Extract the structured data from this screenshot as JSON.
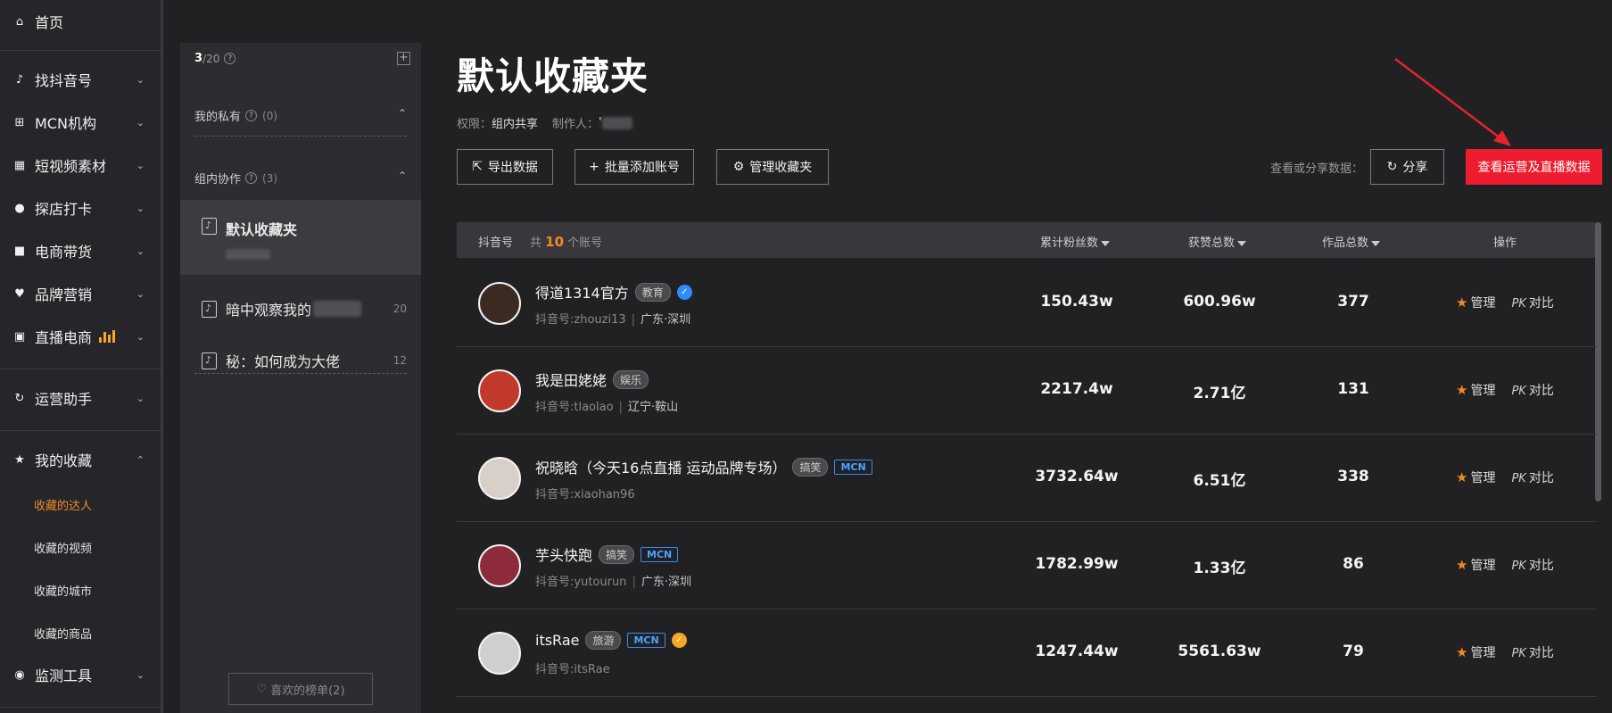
{
  "nav": {
    "home": "首页",
    "items": [
      {
        "label": "找抖音号",
        "icon": "music-note-icon"
      },
      {
        "label": "MCN机构",
        "icon": "org-icon"
      },
      {
        "label": "短视频素材",
        "icon": "grid-icon"
      },
      {
        "label": "探店打卡",
        "icon": "location-pin-icon"
      },
      {
        "label": "电商带货",
        "icon": "shop-bag-icon"
      },
      {
        "label": "品牌营销",
        "icon": "heart-icon"
      },
      {
        "label": "直播电商",
        "icon": "tv-icon"
      },
      {
        "label": "运营助手",
        "icon": "refresh-icon"
      },
      {
        "label": "我的收藏",
        "icon": "star-icon"
      },
      {
        "label": "监测工具",
        "icon": "pulse-icon"
      }
    ],
    "favorites_sub": [
      "收藏的达人",
      "收藏的视频",
      "收藏的城市",
      "收藏的商品"
    ]
  },
  "folders_panel": {
    "count": "3",
    "limit": "/20",
    "private_label": "我的私有",
    "private_count": "(0)",
    "group_label": "组内协作",
    "group_count": "(3)",
    "folders": [
      {
        "name": "默认收藏夹",
        "count": ""
      },
      {
        "name": "暗中观察我的",
        "count": "20"
      },
      {
        "name": "秘：如何成为大佬",
        "count": "12"
      }
    ],
    "liked_lists": "喜欢的榜单(2)"
  },
  "main": {
    "title": "默认收藏夹",
    "perm_label": "权限：",
    "perm_value": "组内共享",
    "maker_label": "制作人：",
    "maker_value": "'",
    "export_btn": "导出数据",
    "batch_add_btn": "批量添加账号",
    "manage_btn": "管理收藏夹",
    "share_label": "查看或分享数据：",
    "share_btn": "分享",
    "view_ops_btn": "查看运营及直播数据"
  },
  "table": {
    "col_account": "抖音号",
    "total_prefix": "共",
    "total_count": "10",
    "total_suffix": "个账号",
    "col_fans": "累计粉丝数",
    "col_likes": "获赞总数",
    "col_works": "作品总数",
    "col_ops": "操作",
    "manage_label": "管理",
    "pk_label": "PK",
    "compare_label": "对比",
    "rows": [
      {
        "name": "得道1314官方",
        "tag": "教育",
        "mcn": false,
        "verified": "blue",
        "id": "抖音号:zhouzi13",
        "loc": "广东·深圳",
        "fans": "150.43w",
        "likes": "600.96w",
        "works": "377",
        "avatar_color": "#3a2a22"
      },
      {
        "name": "我是田姥姥",
        "tag": "娱乐",
        "mcn": false,
        "verified": "",
        "id": "抖音号:tlaolao",
        "loc": "辽宁·鞍山",
        "fans": "2217.4w",
        "likes": "2.71亿",
        "works": "131",
        "avatar_color": "#c0392b"
      },
      {
        "name": "祝晓晗（今天16点直播 运动品牌专场）",
        "tag": "搞笑",
        "mcn": true,
        "verified": "",
        "id": "抖音号:xiaohan96",
        "loc": "",
        "fans": "3732.64w",
        "likes": "6.51亿",
        "works": "338",
        "avatar_color": "#d8cfc8"
      },
      {
        "name": "芋头快跑",
        "tag": "搞笑",
        "mcn": true,
        "verified": "",
        "id": "抖音号:yutourun",
        "loc": "广东·深圳",
        "fans": "1782.99w",
        "likes": "1.33亿",
        "works": "86",
        "avatar_color": "#8e2b3a"
      },
      {
        "name": "itsRae",
        "tag": "旅游",
        "mcn": true,
        "verified": "gold",
        "id": "抖音号:itsRae",
        "loc": "",
        "fans": "1247.44w",
        "likes": "5561.63w",
        "works": "79",
        "avatar_color": "#cfcfcf"
      }
    ]
  },
  "colors": {
    "accent": "#f08a24",
    "primary_red": "#ed1c2e",
    "mcn_blue": "#3a8bf0"
  }
}
